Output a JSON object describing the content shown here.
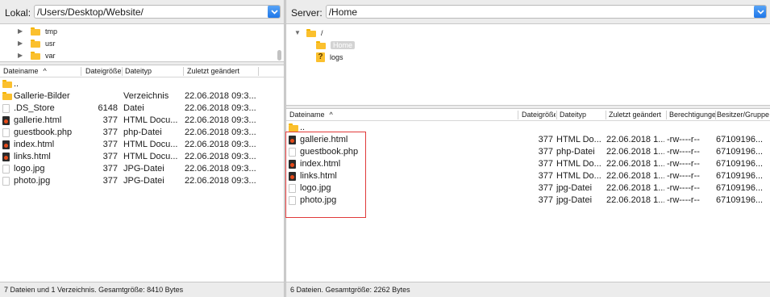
{
  "local": {
    "path_label": "Lokal:",
    "path_value": "/Users/Desktop/Website/",
    "tree": [
      {
        "label": "tmp"
      },
      {
        "label": "usr"
      },
      {
        "label": "var"
      }
    ],
    "columns": {
      "name": "Dateiname",
      "size": "Dateigröße",
      "type": "Dateityp",
      "modified": "Zuletzt geändert"
    },
    "files": [
      {
        "name": "..",
        "size": "",
        "type": "",
        "modified": "",
        "icon": "folder-icon"
      },
      {
        "name": "Gallerie-Bilder",
        "size": "",
        "type": "Verzeichnis",
        "modified": "22.06.2018 09:3...",
        "icon": "folder-icon"
      },
      {
        "name": ".DS_Store",
        "size": "6148",
        "type": "Datei",
        "modified": "22.06.2018 09:3...",
        "icon": "file-icon"
      },
      {
        "name": "gallerie.html",
        "size": "377",
        "type": "HTML Docu...",
        "modified": "22.06.2018 09:3...",
        "icon": "html-file-icon"
      },
      {
        "name": "guestbook.php",
        "size": "377",
        "type": "php-Datei",
        "modified": "22.06.2018 09:3...",
        "icon": "file-icon"
      },
      {
        "name": "index.html",
        "size": "377",
        "type": "HTML Docu...",
        "modified": "22.06.2018 09:3...",
        "icon": "html-file-icon"
      },
      {
        "name": "links.html",
        "size": "377",
        "type": "HTML Docu...",
        "modified": "22.06.2018 09:3...",
        "icon": "html-file-icon"
      },
      {
        "name": "logo.jpg",
        "size": "377",
        "type": "JPG-Datei",
        "modified": "22.06.2018 09:3...",
        "icon": "file-icon"
      },
      {
        "name": "photo.jpg",
        "size": "377",
        "type": "JPG-Datei",
        "modified": "22.06.2018 09:3...",
        "icon": "file-icon"
      }
    ],
    "status": "7 Dateien und 1 Verzeichnis. Gesamtgröße: 8410 Bytes"
  },
  "remote": {
    "path_label": "Server:",
    "path_value": "/Home",
    "tree": [
      {
        "label": "/"
      },
      {
        "label": "Home"
      },
      {
        "label": "logs"
      }
    ],
    "columns": {
      "name": "Dateiname",
      "size": "Dateigröße",
      "type": "Dateityp",
      "modified": "Zuletzt geändert",
      "permissions": "Berechtigungen",
      "owner": "Besitzer/Gruppe"
    },
    "files": [
      {
        "name": "..",
        "size": "",
        "type": "",
        "modified": "",
        "permissions": "",
        "owner": "",
        "icon": "folder-icon"
      },
      {
        "name": "gallerie.html",
        "size": "377",
        "type": "HTML Do...",
        "modified": "22.06.2018 1...",
        "permissions": "-rw----r--",
        "owner": "67109196...",
        "icon": "html-file-icon"
      },
      {
        "name": "guestbook.php",
        "size": "377",
        "type": "php-Datei",
        "modified": "22.06.2018 1...",
        "permissions": "-rw----r--",
        "owner": "67109196...",
        "icon": "file-icon"
      },
      {
        "name": "index.html",
        "size": "377",
        "type": "HTML Do...",
        "modified": "22.06.2018 1...",
        "permissions": "-rw----r--",
        "owner": "67109196...",
        "icon": "html-file-icon"
      },
      {
        "name": "links.html",
        "size": "377",
        "type": "HTML Do...",
        "modified": "22.06.2018 1...",
        "permissions": "-rw----r--",
        "owner": "67109196...",
        "icon": "html-file-icon"
      },
      {
        "name": "logo.jpg",
        "size": "377",
        "type": "jpg-Datei",
        "modified": "22.06.2018 1...",
        "permissions": "-rw----r--",
        "owner": "67109196...",
        "icon": "file-icon"
      },
      {
        "name": "photo.jpg",
        "size": "377",
        "type": "jpg-Datei",
        "modified": "22.06.2018 1...",
        "permissions": "-rw----r--",
        "owner": "67109196...",
        "icon": "file-icon"
      }
    ],
    "status": "6 Dateien. Gesamtgröße: 2262 Bytes"
  },
  "colors": {
    "accent": "#1a73e8",
    "highlight_box": "#e03a3a",
    "folder": "#fbc02d"
  }
}
